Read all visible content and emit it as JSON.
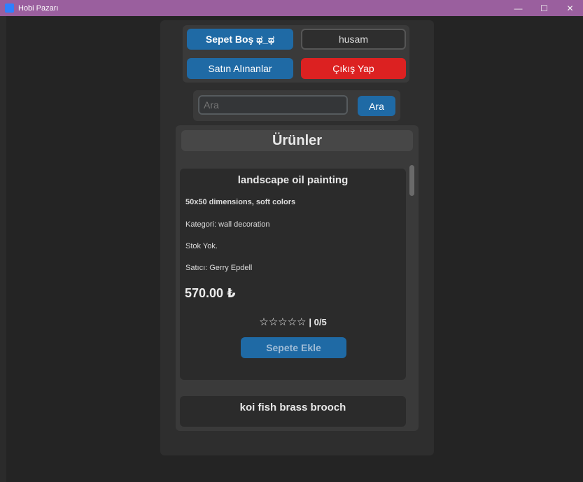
{
  "window": {
    "title": "Hobi Pazarı",
    "controls": {
      "minimize": "—",
      "maximize": "☐",
      "close": "✕"
    }
  },
  "header": {
    "cart_label": "Sepet Boş ಥ_ಥ",
    "username": "husam",
    "purchased_label": "Satın Alınanlar",
    "logout_label": "Çıkış Yap"
  },
  "search": {
    "placeholder": "Ara",
    "button_label": "Ara"
  },
  "products": {
    "heading": "Ürünler",
    "items": [
      {
        "title": "landscape oil painting",
        "description": "50x50 dimensions, soft colors",
        "category": "Kategori: wall decoration",
        "stock": "Stok Yok.",
        "seller": "Satıcı: Gerry Epdell",
        "price": "570.00 ₺",
        "stars": "☆☆☆☆☆",
        "rating": "| 0/5",
        "add_label": "Sepete Ekle"
      },
      {
        "title": "koi fish brass brooch"
      }
    ]
  },
  "colors": {
    "titlebar": "#9a5f9e",
    "accent_blue": "#1f6aa5",
    "danger_red": "#dc2121",
    "background": "#242424"
  }
}
